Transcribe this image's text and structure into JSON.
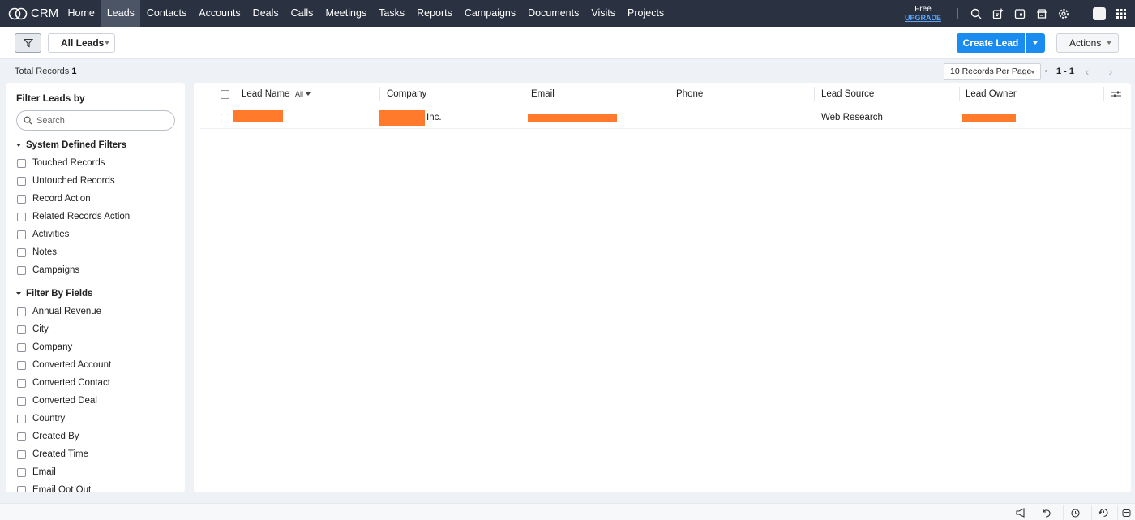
{
  "app": {
    "name": "CRM"
  },
  "nav": {
    "items": [
      "Home",
      "Leads",
      "Contacts",
      "Accounts",
      "Deals",
      "Calls",
      "Meetings",
      "Tasks",
      "Reports",
      "Campaigns",
      "Documents",
      "Visits",
      "Projects"
    ],
    "active": "Leads",
    "plan_label": "Free",
    "upgrade_label": "UPGRADE",
    "icons": [
      "search-icon",
      "add-record-icon",
      "calendar-icon",
      "marketplace-icon",
      "settings-icon",
      "avatar",
      "apps-grid-icon"
    ]
  },
  "toolbar": {
    "view_label": "All Leads",
    "create_label": "Create Lead",
    "actions_label": "Actions"
  },
  "records": {
    "total_label": "Total Records",
    "total_value": "1",
    "per_page": "10 Records Per Page",
    "range": "1 - 1"
  },
  "sidebar": {
    "title": "Filter Leads by",
    "search_placeholder": "Search",
    "system_section": "System Defined Filters",
    "system_items": [
      "Touched Records",
      "Untouched Records",
      "Record Action",
      "Related Records Action",
      "Activities",
      "Notes",
      "Campaigns"
    ],
    "fields_section": "Filter By Fields",
    "field_items": [
      "Annual Revenue",
      "City",
      "Company",
      "Converted Account",
      "Converted Contact",
      "Converted Deal",
      "Country",
      "Created By",
      "Created Time",
      "Email",
      "Email Opt Out"
    ]
  },
  "table": {
    "columns": [
      "Lead Name",
      "Company",
      "Email",
      "Phone",
      "Lead Source",
      "Lead Owner"
    ],
    "lead_name_filter": "All",
    "rows": [
      {
        "lead_name": "",
        "company_suffix": "Inc.",
        "email": "",
        "phone": "",
        "lead_source": "Web Research",
        "lead_owner": ""
      }
    ]
  },
  "colors": {
    "nav_bg": "#2a3140",
    "accent": "#1a8cf0",
    "redaction": "#ff7a2a"
  },
  "bottombar": {
    "icons": [
      "announcement-icon",
      "undo-icon",
      "alarm-icon",
      "history-icon",
      "feedback-icon"
    ]
  }
}
